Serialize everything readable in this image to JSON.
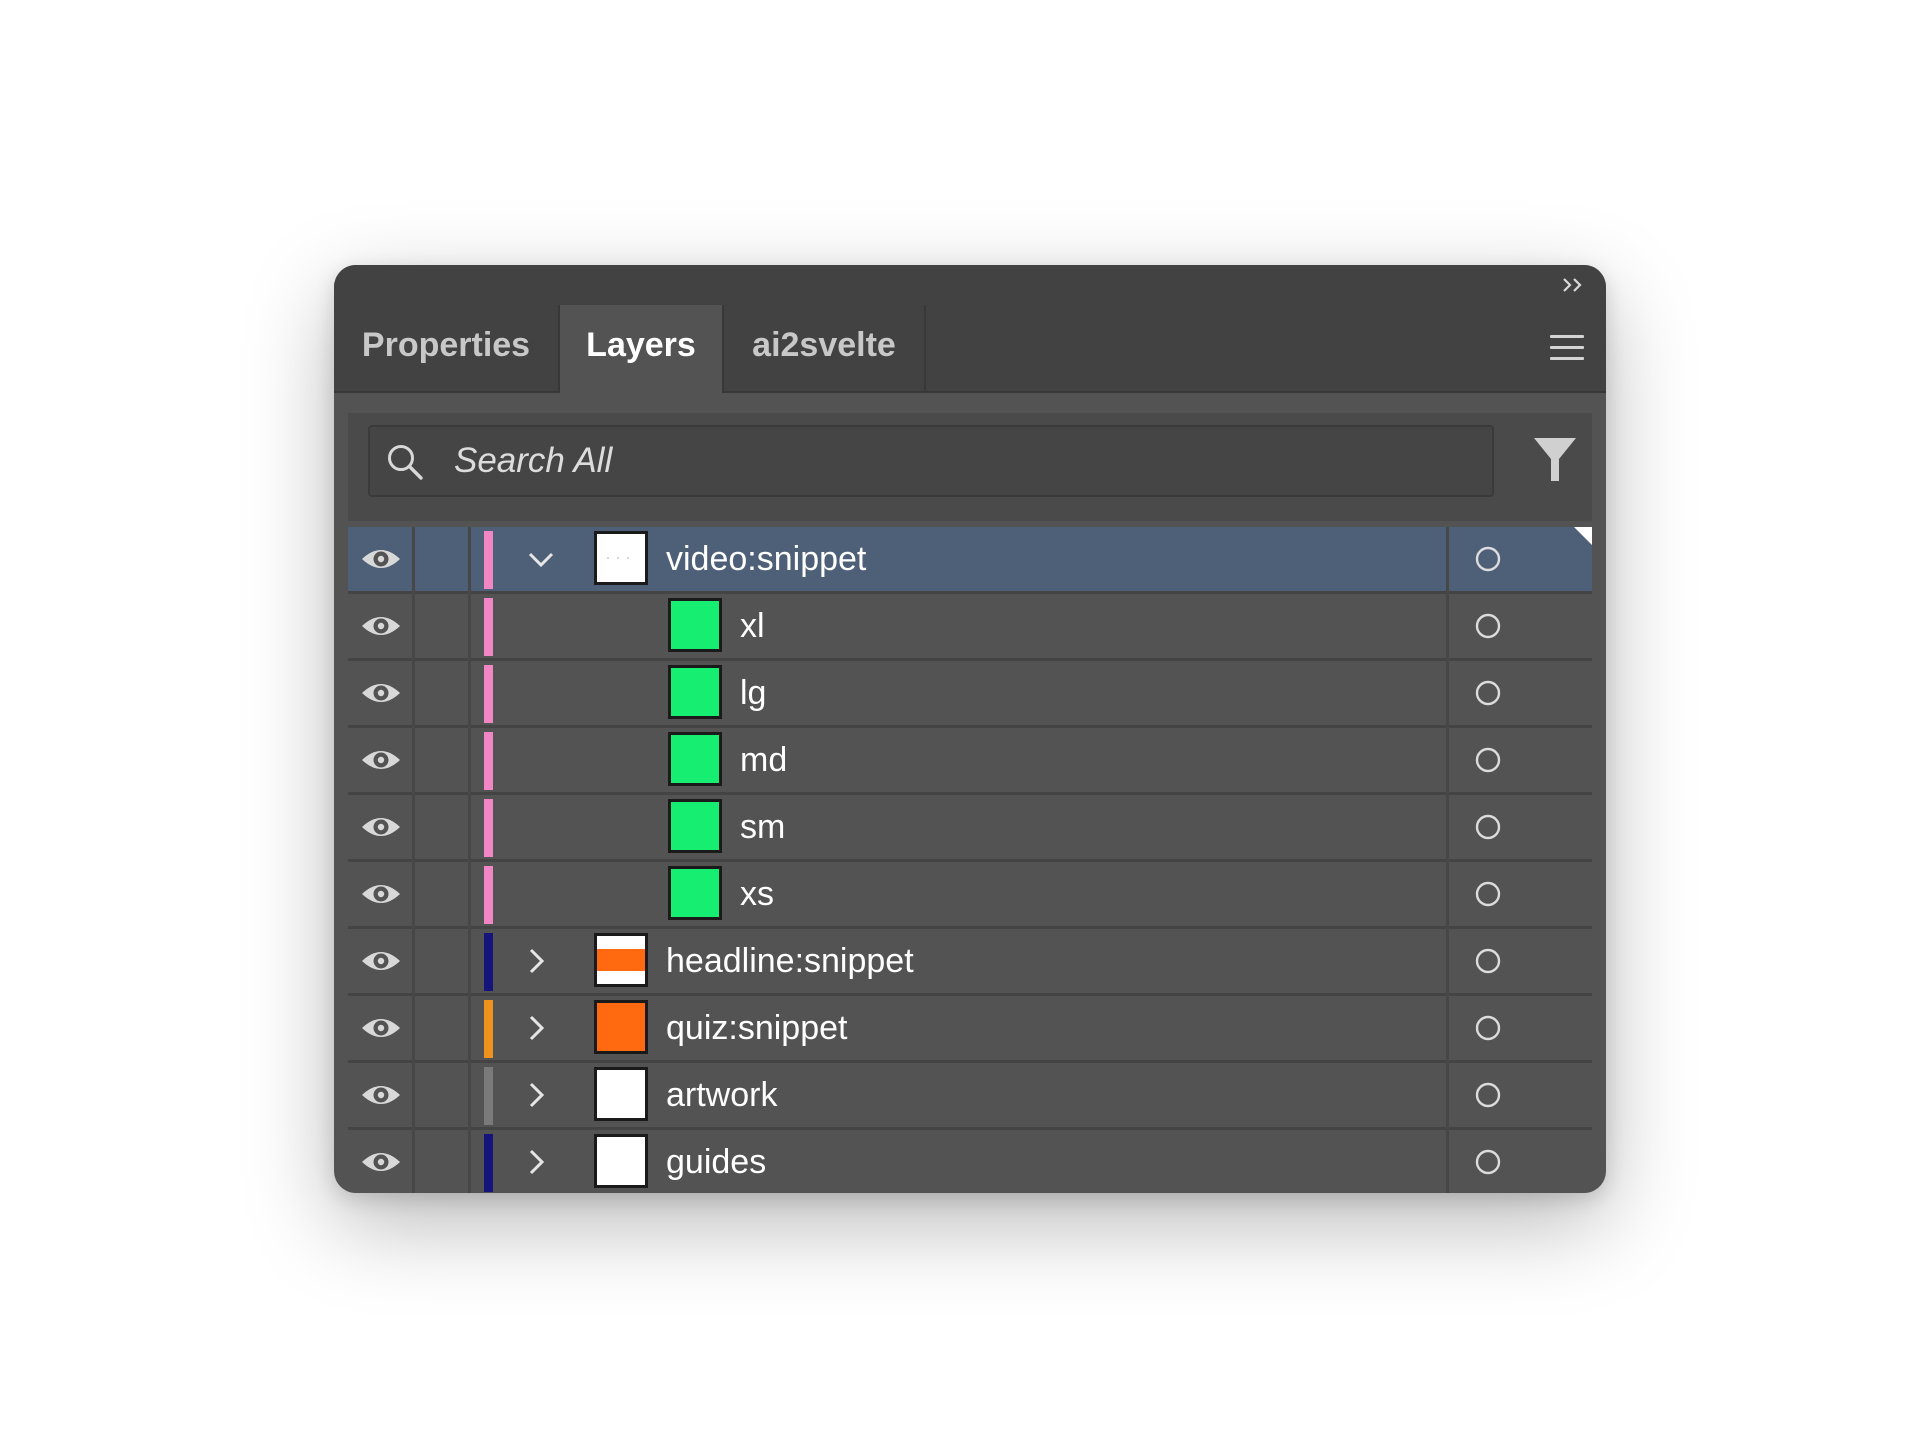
{
  "tabs": [
    {
      "label": "Properties",
      "active": false
    },
    {
      "label": "Layers",
      "active": true
    },
    {
      "label": "ai2svelte",
      "active": false
    }
  ],
  "search": {
    "placeholder": "Search All",
    "value": ""
  },
  "icons": {
    "collapse": "double-chevron-right-icon",
    "menu": "hamburger-menu-icon",
    "search": "search-icon",
    "filter": "filter-icon",
    "visibility": "eye-icon",
    "target": "target-circle-icon"
  },
  "colors": {
    "panel_bg": "#535353",
    "selected_row": "#4e6078",
    "pink": "#f087c4",
    "navy": "#14147a",
    "orange": "#f0921e",
    "gray": "#7a7a7a",
    "green": "#16ee72",
    "thumb_orange": "#ff6a10"
  },
  "layers": [
    {
      "name": "video:snippet",
      "color": "#f087c4",
      "expanded": true,
      "selected": true,
      "level": 0,
      "thumb": "white-dotted",
      "visible": true
    },
    {
      "name": "xl",
      "color": "#f087c4",
      "level": 1,
      "thumb": "green",
      "visible": true
    },
    {
      "name": "lg",
      "color": "#f087c4",
      "level": 1,
      "thumb": "green",
      "visible": true
    },
    {
      "name": "md",
      "color": "#f087c4",
      "level": 1,
      "thumb": "green",
      "visible": true
    },
    {
      "name": "sm",
      "color": "#f087c4",
      "level": 1,
      "thumb": "green",
      "visible": true
    },
    {
      "name": "xs",
      "color": "#f087c4",
      "level": 1,
      "thumb": "green",
      "visible": true
    },
    {
      "name": "headline:snippet",
      "color": "#14147a",
      "expanded": false,
      "level": 0,
      "thumb": "orange-band",
      "visible": true
    },
    {
      "name": "quiz:snippet",
      "color": "#f0921e",
      "expanded": false,
      "level": 0,
      "thumb": "orange",
      "visible": true
    },
    {
      "name": "artwork",
      "color": "#7a7a7a",
      "expanded": false,
      "level": 0,
      "thumb": "white",
      "visible": true
    },
    {
      "name": "guides",
      "color": "#14147a",
      "expanded": false,
      "level": 0,
      "thumb": "white",
      "visible": true
    }
  ]
}
